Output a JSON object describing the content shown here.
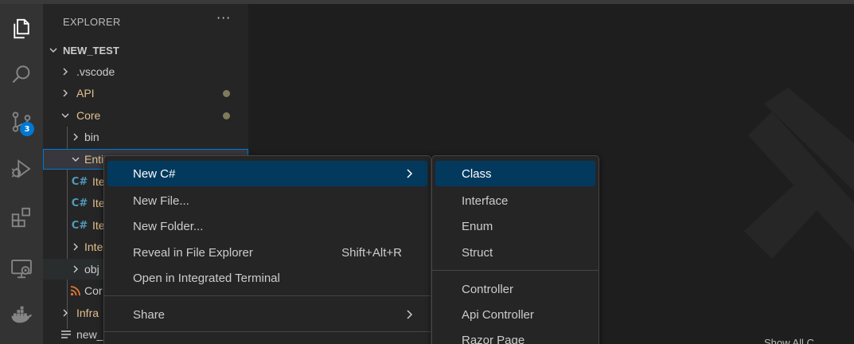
{
  "explorer": {
    "title": "EXPLORER",
    "more_label": "···",
    "tree": [
      {
        "label": "NEW_TEST",
        "kind": "root",
        "expanded": true
      },
      {
        "label": ".vscode",
        "kind": "folder",
        "expanded": false
      },
      {
        "label": "API",
        "kind": "folder",
        "expanded": false,
        "modified": true
      },
      {
        "label": "Core",
        "kind": "folder",
        "expanded": true,
        "modified": true
      },
      {
        "label": "bin",
        "kind": "folder",
        "expanded": false
      },
      {
        "label": "Entities",
        "kind": "folder",
        "expanded": true,
        "visible_label": "Entiti"
      },
      {
        "label": "Ite",
        "kind": "cs-file"
      },
      {
        "label": "Ite",
        "kind": "cs-file"
      },
      {
        "label": "Ite",
        "kind": "cs-file"
      },
      {
        "label": "Inte",
        "kind": "folder",
        "expanded": false
      },
      {
        "label": "obj",
        "kind": "folder",
        "expanded": false
      },
      {
        "label": "Cor",
        "kind": "rss-file"
      },
      {
        "label": "Infra",
        "kind": "folder",
        "expanded": false
      },
      {
        "label": "new_",
        "kind": "file"
      }
    ]
  },
  "activity_bar": {
    "items": [
      "explorer-icon",
      "search-icon",
      "source-control-icon",
      "run-debug-icon",
      "extensions-icon",
      "remote-explorer-icon",
      "docker-icon"
    ],
    "source_control_badge": "3"
  },
  "context_menu": {
    "items": [
      {
        "label": "New C#",
        "has_submenu": true,
        "active": true
      },
      {
        "label": "New File..."
      },
      {
        "label": "New Folder..."
      },
      {
        "label": "Reveal in File Explorer",
        "shortcut": "Shift+Alt+R"
      },
      {
        "label": "Open in Integrated Terminal"
      },
      {
        "label": "Share",
        "has_submenu": true
      }
    ]
  },
  "submenu": {
    "items": [
      {
        "label": "Class",
        "active": true
      },
      {
        "label": "Interface"
      },
      {
        "label": "Enum"
      },
      {
        "label": "Struct"
      },
      {
        "label": "Controller"
      },
      {
        "label": "Api Controller"
      },
      {
        "label": "Razor Page"
      }
    ]
  },
  "editor": {
    "watermark_hint": "Show All C"
  },
  "colors": {
    "accent": "#0078d4",
    "menu_active": "#04395e",
    "folder_modified": "#e2c08d",
    "modified_dot": "#7f7a5a",
    "cs_icon": "#519aba",
    "rss_icon": "#e37933"
  }
}
